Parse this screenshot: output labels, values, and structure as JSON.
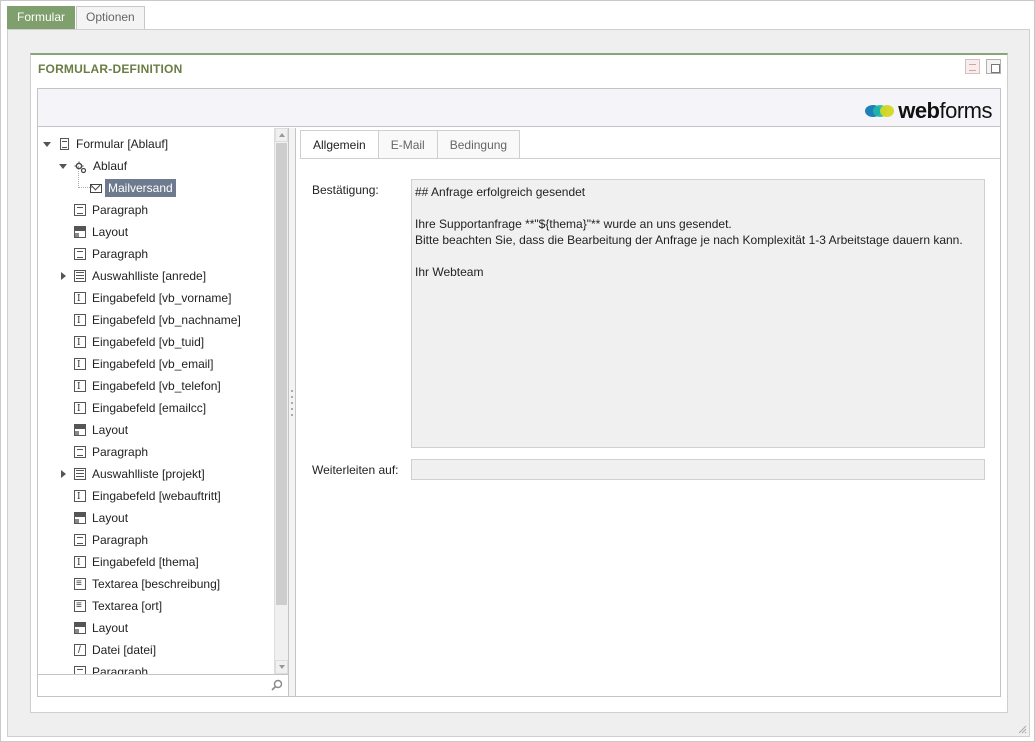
{
  "top_tabs": [
    {
      "label": "Formular",
      "active": true
    },
    {
      "label": "Optionen",
      "active": false
    }
  ],
  "panel": {
    "title": "FORMULAR-DEFINITION"
  },
  "logo": {
    "bold": "web",
    "rest": "forms",
    "colors": [
      "#1f7fb8",
      "#1fb8a6",
      "#d5d622"
    ]
  },
  "tree": {
    "items": [
      {
        "label": "Formular [Ablauf]",
        "icon": "form-icon",
        "level": 0,
        "toggle": "open"
      },
      {
        "label": "Ablauf",
        "icon": "gear-icon",
        "level": 1,
        "toggle": "open"
      },
      {
        "label": "Mailversand",
        "icon": "mail-icon",
        "level": 2,
        "toggle": "none",
        "selected": true
      },
      {
        "label": "Paragraph",
        "icon": "paragraph-icon",
        "level": 1,
        "toggle": "none"
      },
      {
        "label": "Layout",
        "icon": "layout-icon",
        "level": 1,
        "toggle": "none"
      },
      {
        "label": "Paragraph",
        "icon": "paragraph-icon",
        "level": 1,
        "toggle": "none"
      },
      {
        "label": "Auswahlliste [anrede]",
        "icon": "select-list-icon",
        "level": 1,
        "toggle": "closed"
      },
      {
        "label": "Eingabefeld [vb_vorname]",
        "icon": "input-field-icon",
        "level": 1,
        "toggle": "none"
      },
      {
        "label": "Eingabefeld [vb_nachname]",
        "icon": "input-field-icon",
        "level": 1,
        "toggle": "none"
      },
      {
        "label": "Eingabefeld [vb_tuid]",
        "icon": "input-field-icon",
        "level": 1,
        "toggle": "none"
      },
      {
        "label": "Eingabefeld [vb_email]",
        "icon": "input-field-icon",
        "level": 1,
        "toggle": "none"
      },
      {
        "label": "Eingabefeld [vb_telefon]",
        "icon": "input-field-icon",
        "level": 1,
        "toggle": "none"
      },
      {
        "label": "Eingabefeld [emailcc]",
        "icon": "input-field-icon",
        "level": 1,
        "toggle": "none"
      },
      {
        "label": "Layout",
        "icon": "layout-icon",
        "level": 1,
        "toggle": "none"
      },
      {
        "label": "Paragraph",
        "icon": "paragraph-icon",
        "level": 1,
        "toggle": "none"
      },
      {
        "label": "Auswahlliste [projekt]",
        "icon": "select-list-icon",
        "level": 1,
        "toggle": "closed"
      },
      {
        "label": "Eingabefeld [webauftritt]",
        "icon": "input-field-icon",
        "level": 1,
        "toggle": "none"
      },
      {
        "label": "Layout",
        "icon": "layout-icon",
        "level": 1,
        "toggle": "none"
      },
      {
        "label": "Paragraph",
        "icon": "paragraph-icon",
        "level": 1,
        "toggle": "none"
      },
      {
        "label": "Eingabefeld [thema]",
        "icon": "input-field-icon",
        "level": 1,
        "toggle": "none"
      },
      {
        "label": "Textarea [beschreibung]",
        "icon": "textarea-icon",
        "level": 1,
        "toggle": "none"
      },
      {
        "label": "Textarea [ort]",
        "icon": "textarea-icon",
        "level": 1,
        "toggle": "none"
      },
      {
        "label": "Layout",
        "icon": "layout-icon",
        "level": 1,
        "toggle": "none"
      },
      {
        "label": "Datei [datei]",
        "icon": "file-icon",
        "level": 1,
        "toggle": "none"
      },
      {
        "label": "Paragraph",
        "icon": "paragraph-icon",
        "level": 1,
        "toggle": "none"
      }
    ],
    "search_value": ""
  },
  "inner_tabs": [
    {
      "label": "Allgemein",
      "active": true
    },
    {
      "label": "E-Mail",
      "active": false
    },
    {
      "label": "Bedingung",
      "active": false
    }
  ],
  "form": {
    "confirmation_label": "Bestätigung:",
    "confirmation_value": "## Anfrage erfolgreich gesendet\n\nIhre Supportanfrage **\"${thema}\"** wurde an uns gesendet.\nBitte beachten Sie, dass die Bearbeitung der Anfrage je nach Komplexität 1-3 Arbeitstage dauern kann.\n\nIhr Webteam",
    "forward_label": "Weiterleiten auf:",
    "forward_value": ""
  }
}
